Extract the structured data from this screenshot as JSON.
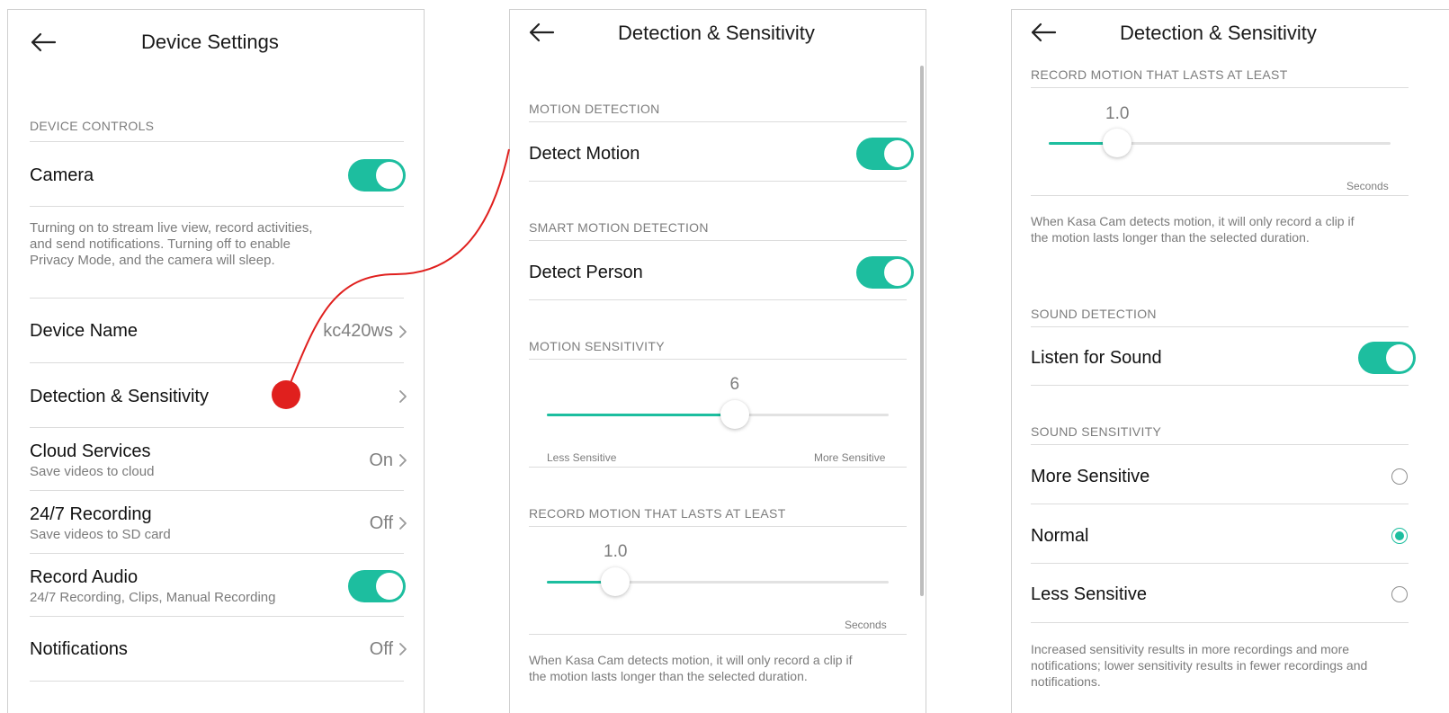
{
  "accent_color": "#1dbe9f",
  "annotation_color": "#e0201e",
  "device_settings": {
    "title": "Device Settings",
    "back_icon": "arrow-left-icon",
    "section_device_controls": "DEVICE CONTROLS",
    "camera": {
      "label": "Camera",
      "on": true
    },
    "camera_description": [
      "Turning on to stream live view, record activities,",
      "and send notifications. Turning off to enable",
      "Privacy Mode, and the camera will sleep."
    ],
    "device_name": {
      "label": "Device Name",
      "value": "kc420ws"
    },
    "detection": {
      "label": "Detection & Sensitivity"
    },
    "cloud": {
      "label": "Cloud Services",
      "sub": "Save videos to cloud",
      "value": "On"
    },
    "recording": {
      "label": "24/7 Recording",
      "sub": "Save videos to SD card",
      "value": "Off"
    },
    "audio": {
      "label": "Record Audio",
      "sub": "24/7 Recording, Clips, Manual Recording",
      "on": true
    },
    "notifications": {
      "label": "Notifications",
      "value": "Off"
    }
  },
  "detection_screen": {
    "title": "Detection & Sensitivity",
    "section_motion_detection": "MOTION DETECTION",
    "detect_motion": {
      "label": "Detect Motion",
      "on": true
    },
    "section_smart_motion": "SMART MOTION DETECTION",
    "detect_person": {
      "label": "Detect Person",
      "on": true
    },
    "section_motion_sensitivity": "MOTION SENSITIVITY",
    "motion_sensitivity": {
      "value": "6",
      "fraction": 0.55,
      "min_label": "Less Sensitive",
      "max_label": "More Sensitive"
    },
    "section_record_motion": "RECORD MOTION THAT LASTS AT LEAST",
    "record_motion": {
      "value": "1.0",
      "fraction": 0.2,
      "unit": "Seconds"
    },
    "record_motion_description": [
      "When Kasa Cam detects motion, it will only record a clip if",
      "the motion lasts longer than the selected duration."
    ]
  },
  "detection_screen_scrolled": {
    "title": "Detection & Sensitivity",
    "section_record_motion": "RECORD MOTION THAT LASTS AT LEAST",
    "record_motion": {
      "value": "1.0",
      "fraction": 0.2,
      "unit": "Seconds"
    },
    "record_motion_description": [
      "When Kasa Cam detects motion, it will only record a clip if",
      "the motion lasts longer than the selected duration."
    ],
    "section_sound_detection": "SOUND DETECTION",
    "listen_sound": {
      "label": "Listen for Sound",
      "on": true
    },
    "section_sound_sensitivity": "SOUND SENSITIVITY",
    "options": [
      {
        "label": "More Sensitive",
        "selected": false
      },
      {
        "label": "Normal",
        "selected": true
      },
      {
        "label": "Less Sensitive",
        "selected": false
      }
    ],
    "sound_description": [
      "Increased sensitivity results in more recordings and more",
      "notifications; lower sensitivity results in fewer recordings and",
      "notifications."
    ]
  }
}
